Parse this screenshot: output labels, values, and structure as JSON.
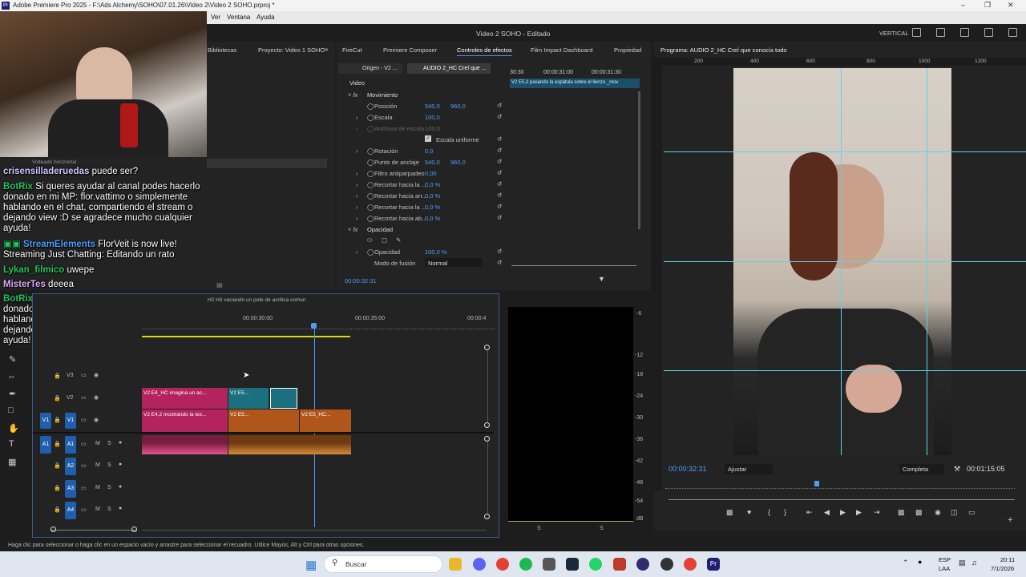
{
  "titlebar": {
    "title": "Adobe Premiere Pro 2025 - F:\\Ads Alchemy\\SOHO\\07.01.26\\Video 2\\Video 2 SOHO.prproj *"
  },
  "menubar": {
    "items": [
      "Ver",
      "Ventana",
      "Ayuda"
    ]
  },
  "header": {
    "sequence_title": "Video 2 SOHO - Editado",
    "workspace": "VERTICAL"
  },
  "project_panel": {
    "tabs": [
      "Bibliotecas",
      "Proyecto: Video 1 SOHO"
    ],
    "behind_label": "Volteado horizontal"
  },
  "chat": {
    "messages": [
      {
        "user": "crisensilladeruedas",
        "text": "puede ser?",
        "color": "#c8c8ff"
      },
      {
        "user": "BotRix",
        "text": "Si queres ayudar al canal podes hacerlo donado en mi MP: flor.vattimo o simplemente hablando en el chat, compartiendo el stream o dejando view :D se agradece mucho cualquier ayuda!",
        "color": "#22c55e"
      },
      {
        "user": "StreamElements",
        "text": "FlorVeit is now live! Streaming Just Chatting: Editando un rato",
        "color": "#4f9cf7"
      },
      {
        "user": "Lykan_filmico",
        "text": "uwepe",
        "color": "#22c55e"
      },
      {
        "user": "MisterTes",
        "text": "deeea",
        "color": "#d8a6f5"
      },
      {
        "user": "BotRix",
        "text": "Si queres ayudar al canal podes hacerlo donado en mi MP: flor.vattimo o simplemente hablando en el chat, compartiendo el stream o dejando view :D se agradece mucho cualquier ayuda!",
        "color": "#22c55e"
      }
    ]
  },
  "effects_panel": {
    "tabs": [
      "FireCut",
      "Premiere Composer",
      "Controles de efectos",
      "Film Impact Dashboard",
      "Propiedad"
    ],
    "source_tab": "Origen - V2 ...",
    "clip_tab": "AUDIO 2_HC Creí que ...",
    "mini_times": [
      "30:30",
      "00:00:31:00",
      "00:00:31:30"
    ],
    "clip_bar": "V2 E5,2 pasando la espátula sobre el lienzo _mov",
    "section_video": "Video",
    "rows": [
      {
        "label": "Movimiento",
        "v1": "",
        "v2": ""
      },
      {
        "label": "Posición",
        "v1": "540,0",
        "v2": "960,0"
      },
      {
        "label": "Escala",
        "v1": "100,0",
        "v2": ""
      },
      {
        "label": "Anchura de escala",
        "v1": "100,0",
        "v2": ""
      },
      {
        "label": "Escala uniforme",
        "v1": "",
        "v2": ""
      },
      {
        "label": "Rotación",
        "v1": "0,0",
        "v2": ""
      },
      {
        "label": "Punto de anclaje",
        "v1": "540,0",
        "v2": "960,0"
      },
      {
        "label": "Filtro antiparpadeo",
        "v1": "0,00",
        "v2": ""
      },
      {
        "label": "Recortar hacia la ...",
        "v1": "0,0 %",
        "v2": ""
      },
      {
        "label": "Recortar hacia arr...",
        "v1": "0,0 %",
        "v2": ""
      },
      {
        "label": "Recortar hacia la ...",
        "v1": "0,0 %",
        "v2": ""
      },
      {
        "label": "Recortar hacia ab...",
        "v1": "0,0 %",
        "v2": ""
      },
      {
        "label": "Opacidad",
        "v1": "",
        "v2": ""
      },
      {
        "label": "Opacidad",
        "v1": "100,0 %",
        "v2": ""
      },
      {
        "label": "Modo de fusión",
        "v1": "Normal",
        "v2": ""
      }
    ],
    "timecode": "00:00:32:31"
  },
  "program_monitor": {
    "title": "Programa: AUDIO 2_HC Creí que conocía todo",
    "ruler": [
      "200",
      "400",
      "600",
      "800",
      "1000",
      "1200"
    ],
    "timecode": "00:00:32:31",
    "fit": "Ajustar",
    "quality": "Completa",
    "duration": "00:01:15:05"
  },
  "timeline": {
    "clip_title": "H2 H3 vaciando un pote de acrílica comun",
    "ruler": [
      "00:00:30:00",
      "00:00:35:00",
      "00:00:4"
    ],
    "tracks": [
      "V3",
      "V2",
      "V1",
      "A1",
      "A2",
      "A3",
      "A4"
    ],
    "clips": {
      "v2a": "V2 E4_HC imagina un ac...",
      "v2b": "V2 E5...",
      "v1a": "V2 E4,2 mostrando la tex...",
      "v1b": "V2 E5...",
      "v1c": "V2 E5_HC..."
    }
  },
  "meter": {
    "scale": [
      "-6",
      "-12",
      "-18",
      "-24",
      "-30",
      "-36",
      "-42",
      "-48",
      "-54",
      "dB"
    ],
    "bottom": [
      "S",
      "S"
    ]
  },
  "status": {
    "text": "Haga clic para seleccionar o haga clic en un espacio vacío y arrastre para seleccionar el recuadro. Utilice Mayús, Alt y Ctrl para otras opciones."
  },
  "taskbar": {
    "search": "Buscar",
    "lang1": "ESP",
    "lang2": "LAA",
    "time": "20:11",
    "date": "7/1/2026"
  }
}
